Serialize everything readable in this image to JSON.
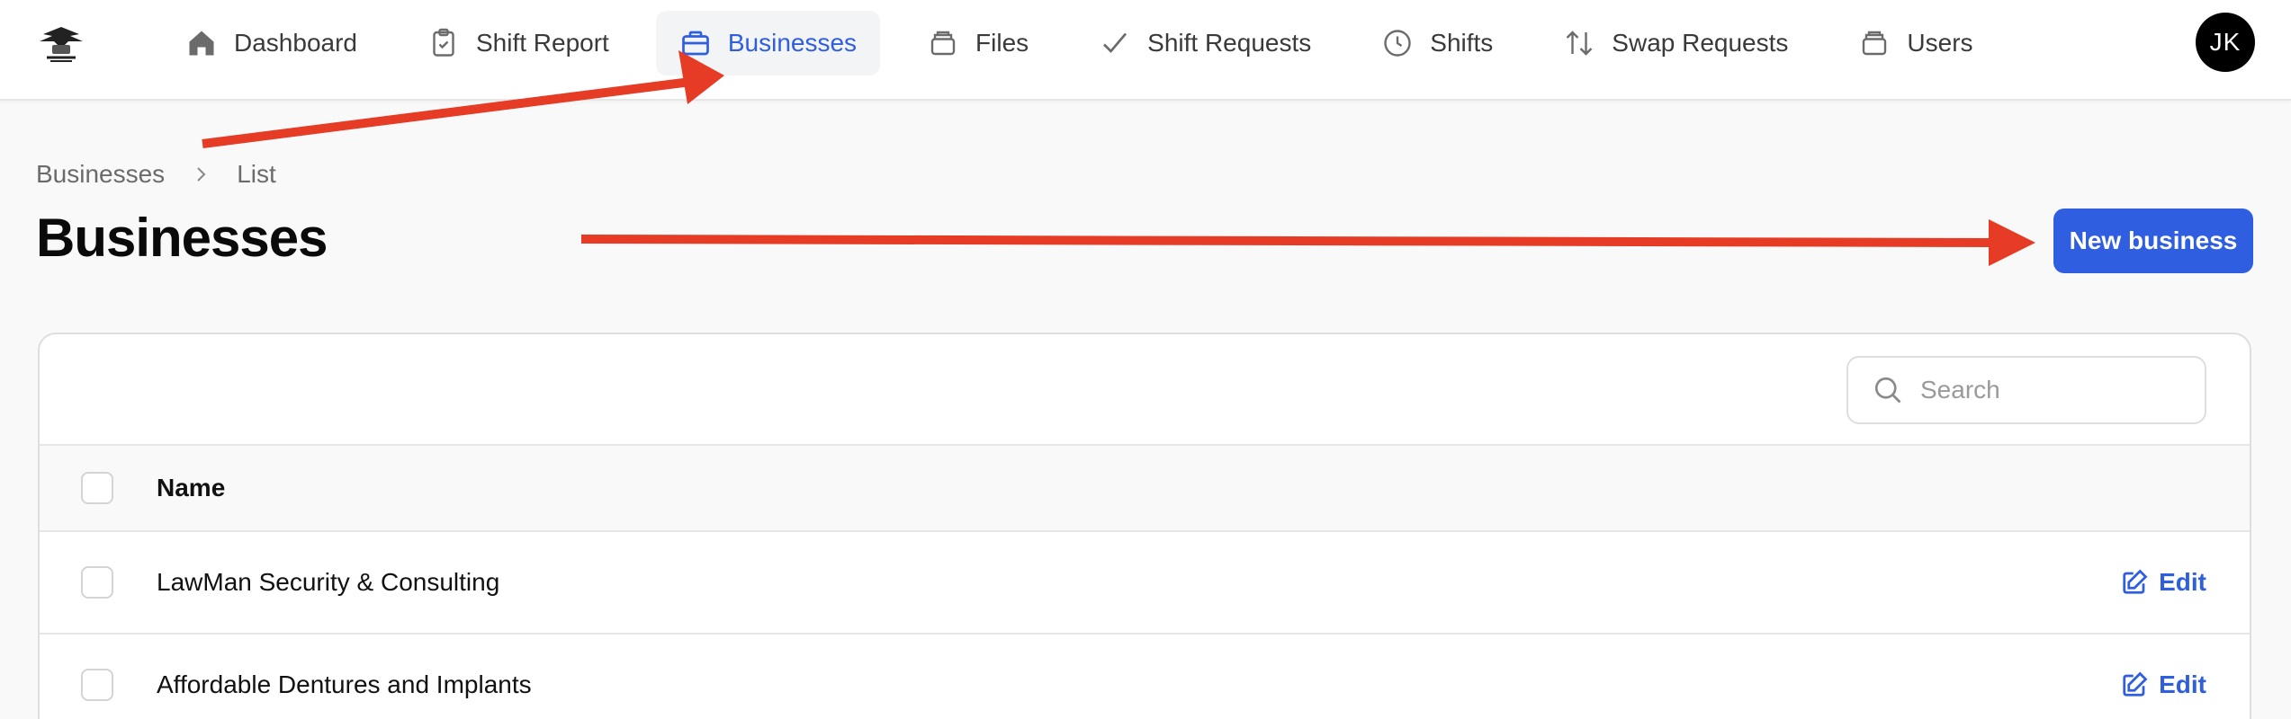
{
  "header": {
    "nav": [
      {
        "label": "Dashboard",
        "icon": "home-icon"
      },
      {
        "label": "Shift Report",
        "icon": "clipboard-icon"
      },
      {
        "label": "Businesses",
        "icon": "briefcase-icon"
      },
      {
        "label": "Files",
        "icon": "archive-icon"
      },
      {
        "label": "Shift Requests",
        "icon": "check-icon"
      },
      {
        "label": "Shifts",
        "icon": "clock-icon"
      },
      {
        "label": "Swap Requests",
        "icon": "arrows-updown-icon"
      },
      {
        "label": "Users",
        "icon": "archive-icon"
      }
    ],
    "active_nav": "Businesses",
    "avatar_initials": "JK"
  },
  "breadcrumb": {
    "items": [
      "Businesses",
      "List"
    ]
  },
  "page": {
    "title": "Businesses",
    "new_button_label": "New business"
  },
  "table": {
    "search_placeholder": "Search",
    "columns": [
      "Name"
    ],
    "rows": [
      {
        "name": "LawMan Security & Consulting",
        "action": "Edit"
      },
      {
        "name": "Affordable Dentures and Implants",
        "action": "Edit"
      }
    ]
  },
  "colors": {
    "accent": "#2f5ee0",
    "annotation_arrow": "#e63b25",
    "avatar_bg": "#000000"
  }
}
